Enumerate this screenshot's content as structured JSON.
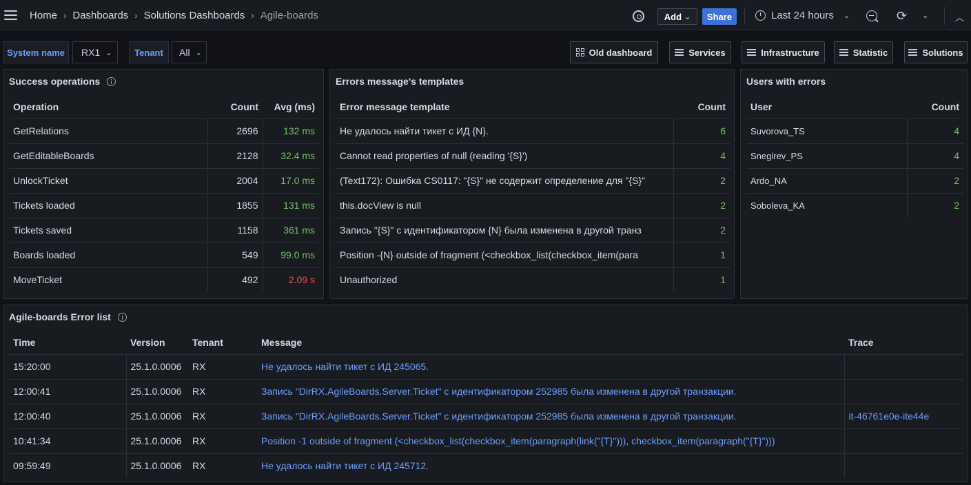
{
  "topbar": {
    "breadcrumbs": [
      "Home",
      "Dashboards",
      "Solutions Dashboards",
      "Agile-boards"
    ],
    "add_label": "Add",
    "share_label": "Share",
    "time_range": "Last 24 hours",
    "icons": [
      "menu-icon",
      "gear-icon",
      "clock-icon",
      "zoom-out-icon",
      "refresh-icon",
      "chevron-up-icon"
    ]
  },
  "variables": {
    "system_label": "System name",
    "system_value": "RX1",
    "tenant_label": "Tenant",
    "tenant_value": "All"
  },
  "links": [
    "Old dashboard",
    "Services",
    "Infrastructure",
    "Statistic",
    "Solutions"
  ],
  "success_panel": {
    "title": "Success operations",
    "columns": [
      "Operation",
      "Count",
      "Avg (ms)"
    ],
    "rows": [
      {
        "op": "GetRelations",
        "count": "2696",
        "avg": "132 ms",
        "status": "green"
      },
      {
        "op": "GetEditableBoards",
        "count": "2128",
        "avg": "32.4 ms",
        "status": "green"
      },
      {
        "op": "UnlockTicket",
        "count": "2004",
        "avg": "17.0 ms",
        "status": "green"
      },
      {
        "op": "Tickets loaded",
        "count": "1855",
        "avg": "131 ms",
        "status": "green"
      },
      {
        "op": "Tickets saved",
        "count": "1158",
        "avg": "361 ms",
        "status": "green"
      },
      {
        "op": "Boards loaded",
        "count": "549",
        "avg": "99.0 ms",
        "status": "green"
      },
      {
        "op": "MoveTicket",
        "count": "492",
        "avg": "2.09 s",
        "status": "red"
      }
    ]
  },
  "templates_panel": {
    "title": "Errors message's templates",
    "columns": [
      "Error message template",
      "Count"
    ],
    "rows": [
      {
        "template": "Не удалось найти тикет с ИД {N}.",
        "count": "6"
      },
      {
        "template": "Cannot read properties of null (reading '{S}')",
        "count": "4"
      },
      {
        "template": "(Text172): Ошибка CS0117: \"{S}\" не содержит определение для \"{S}\"",
        "count": "2"
      },
      {
        "template": "this.docView is null",
        "count": "2"
      },
      {
        "template": "Запись \"{S}\" с идентификатором {N} была изменена в другой транз",
        "count": "2"
      },
      {
        "template": "Position -{N} outside of fragment (<checkbox_list(checkbox_item(para",
        "count": "1"
      },
      {
        "template": "Unauthorized",
        "count": "1"
      }
    ]
  },
  "users_panel": {
    "title": "Users with errors",
    "columns": [
      "User",
      "Count"
    ],
    "rows": [
      {
        "user": "Suvorova_TS",
        "count": "4"
      },
      {
        "user": "Snegirev_PS",
        "count": "4"
      },
      {
        "user": "Ardo_NA",
        "count": "2"
      },
      {
        "user": "Soboleva_KA",
        "count": "2"
      }
    ]
  },
  "errors_panel": {
    "title": "Agile-boards Error list",
    "columns": [
      "Time",
      "Version",
      "Tenant",
      "Message",
      "Trace"
    ],
    "rows": [
      {
        "time": "15:20:00",
        "version": "25.1.0.0006",
        "tenant": "RX",
        "message": "Не удалось найти тикет с ИД 245065.",
        "trace": ""
      },
      {
        "time": "12:00:41",
        "version": "25.1.0.0006",
        "tenant": "RX",
        "message": "Запись \"DirRX.AgileBoards.Server.Ticket\" с идентификатором 252985 была изменена в другой транзакции.",
        "trace": ""
      },
      {
        "time": "12:00:40",
        "version": "25.1.0.0006",
        "tenant": "RX",
        "message": "Запись \"DirRX.AgileBoards.Server.Ticket\" с идентификатором 252985 была изменена в другой транзакции.",
        "trace": "it-46761e0e-ite44e"
      },
      {
        "time": "10:41:34",
        "version": "25.1.0.0006",
        "tenant": "RX",
        "message": "Position -1 outside of fragment (<checkbox_list(checkbox_item(paragraph(link(\"{T}\"))), checkbox_item(paragraph(\"{T}\")))",
        "trace": ""
      },
      {
        "time": "09:59:49",
        "version": "25.1.0.0006",
        "tenant": "RX",
        "message": "Не удалось найти тикет с ИД 245712.",
        "trace": ""
      }
    ]
  }
}
